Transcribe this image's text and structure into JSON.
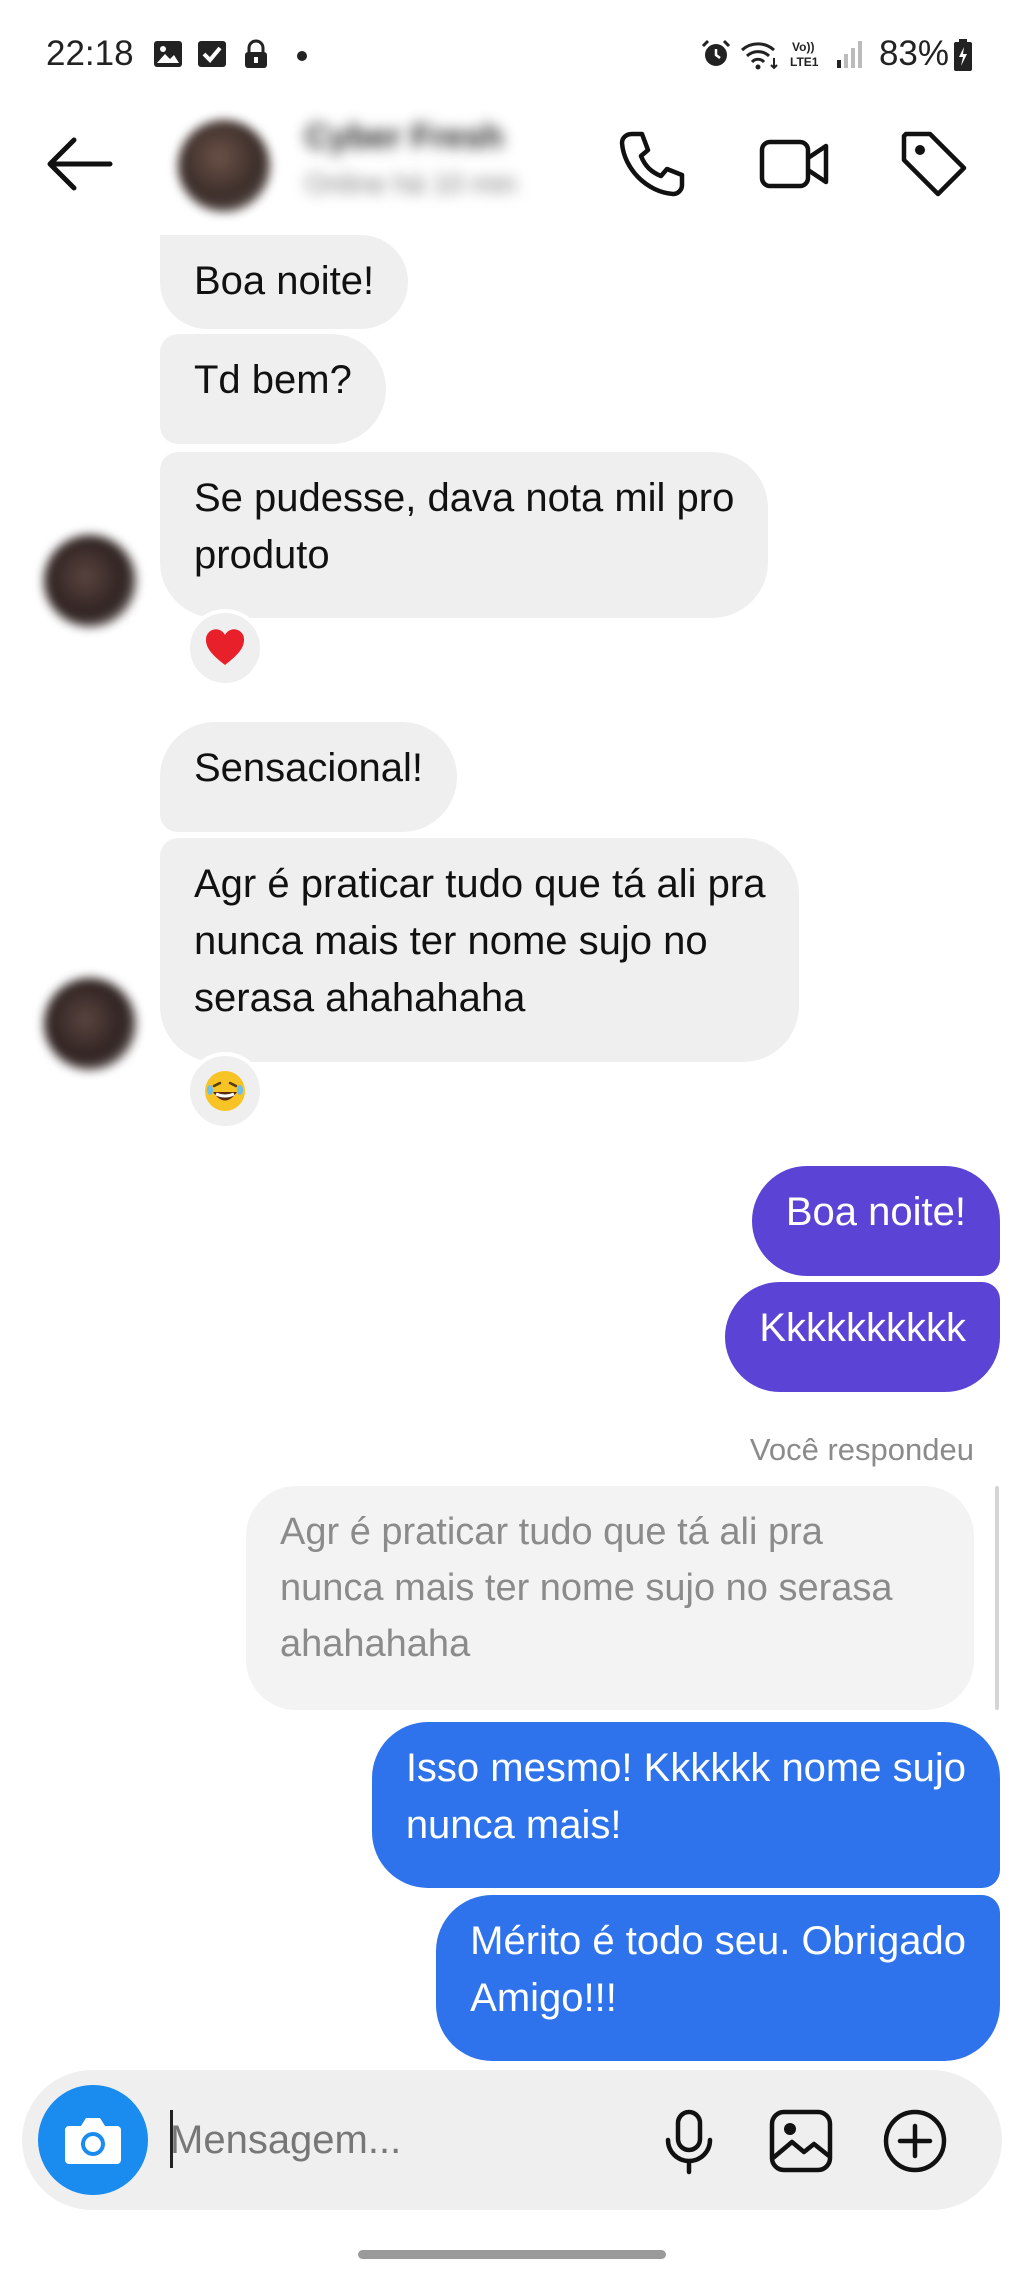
{
  "status_bar": {
    "time": "22:18",
    "battery": "83%",
    "icons": [
      "gallery-icon",
      "checkbox-icon",
      "lock-icon",
      "dot-icon",
      "alarm-icon",
      "wifi-icon",
      "volte-icon",
      "signal-icon",
      "battery-icon"
    ]
  },
  "header": {
    "contact_name": "Cyber Fresh",
    "contact_status": "Online há 10 min",
    "icons": [
      "back-arrow-icon",
      "phone-icon",
      "video-icon",
      "tag-icon"
    ]
  },
  "messages": {
    "m1": "Boa noite!",
    "m2": "Td bem?",
    "m3": "Se pudesse, dava nota mil pro\nproduto",
    "m3_reaction": "❤️",
    "m4": "Sensacional!",
    "m5": "Agr é praticar tudo que tá ali pra\nnunca mais ter nome sujo no\nserasa ahahahaha",
    "m5_reaction": "😂",
    "o1": "Boa noite!",
    "o2": "Kkkkkkkkkk",
    "replied_label": "Você respondeu",
    "quoted": "Agr é praticar tudo que tá ali pra\nnunca mais ter nome sujo no serasa\nahahahaha",
    "o3": "Isso mesmo! Kkkkkk nome sujo\nnunca mais!",
    "o4": "Mérito é todo seu. Obrigado\nAmigo!!!"
  },
  "colors": {
    "incoming_bubble": "#efefef",
    "outgoing_purple": "#5b43d6",
    "outgoing_blue": "#2e72ec",
    "camera_button": "#1a8cf0"
  },
  "composer": {
    "placeholder": "Mensagem...",
    "icons": [
      "camera-icon",
      "microphone-icon",
      "image-icon",
      "plus-circle-icon"
    ]
  }
}
